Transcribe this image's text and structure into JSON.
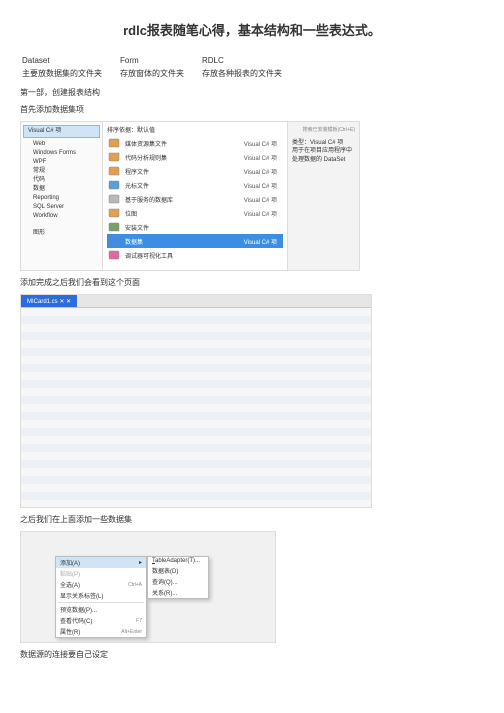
{
  "title": "rdlc报表随笔心得，基本结构和一些表达式。",
  "defs": {
    "r1c1": "Dataset",
    "r1c2": "Form",
    "r1c3": "RDLC",
    "r2c1": "主要放数据集的文件夹",
    "r2c2": "存放窗体的文件夹",
    "r2c3": "存放各种报表的文件夹"
  },
  "p1": "第一部，创建报表结构",
  "p2": "首先添加数据集项",
  "s1": {
    "tree_hdr": "Visual C# 项",
    "tree": [
      "Web",
      "Windows Forms",
      "WPF",
      "常规",
      "代码",
      "数据",
      "Reporting",
      "SQL Server",
      "Workflow"
    ],
    "tree_sp": "图形",
    "sort_label": "排序依据：默认值",
    "search_ph": "搜索已安装模板(Ctrl+E)",
    "items": [
      {
        "label": "媒体资源集文件",
        "tag": "Visual C# 项"
      },
      {
        "label": "代码分析规则集",
        "tag": "Visual C# 项"
      },
      {
        "label": "程序文件",
        "tag": "Visual C# 项"
      },
      {
        "label": "光标文件",
        "tag": "Visual C# 项"
      },
      {
        "label": "基于服务的数据库",
        "tag": "Visual C# 项"
      },
      {
        "label": "位图",
        "tag": "Visual C# 项"
      },
      {
        "label": "安装文件",
        "tag": ""
      },
      {
        "label": "数据集",
        "tag": "Visual C# 项",
        "sel": true
      },
      {
        "label": "调试器可视化工具",
        "tag": ""
      }
    ],
    "right_title": "类型：Visual C# 项",
    "right_desc": "用于在项目应用程序中处理数据的 DataSet"
  },
  "p3": "添加完成之后我们会看到这个页面",
  "s2": {
    "tab": "MICard1.cs ✕ ✕"
  },
  "p4": "之后我们在上面添加一些数据集",
  "s3": {
    "menu_a": [
      {
        "label": "添加(A)",
        "arr": "▸",
        "sel": true
      },
      {
        "label": "粘贴(P)",
        "dis": true
      },
      {
        "label": "全选(A)",
        "sc": "Ctrl+A"
      },
      {
        "label": "显示关系标签(L)"
      },
      {
        "sep": true
      },
      {
        "label": "预览数据(P)..."
      },
      {
        "label": "查看代码(C)",
        "sc": "F7"
      },
      {
        "label": "属性(R)",
        "sc": "Alt+Enter"
      }
    ],
    "menu_b": [
      {
        "label_html": "<u>T</u>ableAdapter(T)..."
      },
      {
        "label": "数据表(D)"
      },
      {
        "label": "查询(Q)..."
      },
      {
        "label": "关系(R)..."
      }
    ]
  },
  "p5": "数据源的连接要自己设定"
}
